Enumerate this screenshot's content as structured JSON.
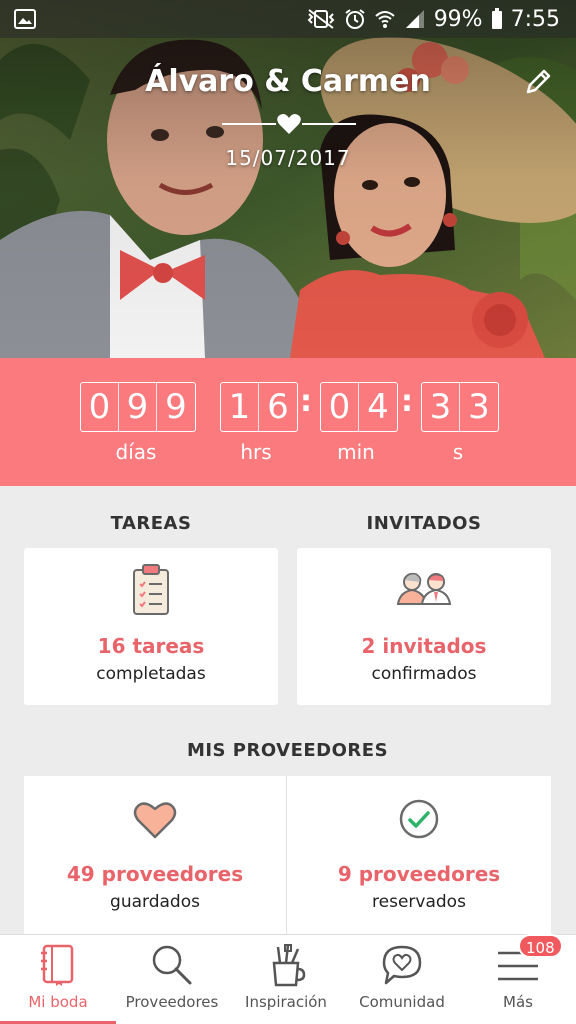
{
  "status_bar": {
    "battery": "99%",
    "time": "7:55"
  },
  "hero": {
    "couple": "Álvaro & Carmen",
    "date": "15/07/2017"
  },
  "countdown": {
    "days": [
      "0",
      "9",
      "9"
    ],
    "hours": [
      "1",
      "6"
    ],
    "minutes": [
      "0",
      "4"
    ],
    "seconds": [
      "3",
      "3"
    ],
    "labels": {
      "days": "días",
      "hours": "hrs",
      "minutes": "min",
      "seconds": "s"
    }
  },
  "tasks": {
    "title": "TAREAS",
    "count": "16 tareas",
    "sub": "completadas"
  },
  "guests": {
    "title": "INVITADOS",
    "count": "2 invitados",
    "sub": "confirmados"
  },
  "vendors": {
    "title": "MIS PROVEEDORES",
    "saved_count": "49 proveedores",
    "saved_sub": "guardados",
    "booked_count": "9 proveedores",
    "booked_sub": "reservados"
  },
  "nav": {
    "items": [
      {
        "label": "Mi boda",
        "icon": "notebook-icon"
      },
      {
        "label": "Proveedores",
        "icon": "search-icon"
      },
      {
        "label": "Inspiración",
        "icon": "brushes-cup-icon"
      },
      {
        "label": "Comunidad",
        "icon": "chat-heart-icon"
      },
      {
        "label": "Más",
        "icon": "menu-icon"
      }
    ],
    "badge": "108"
  },
  "colors": {
    "accent": "#fa7a7e",
    "accent_text": "#e8646a",
    "background": "#ececec"
  }
}
